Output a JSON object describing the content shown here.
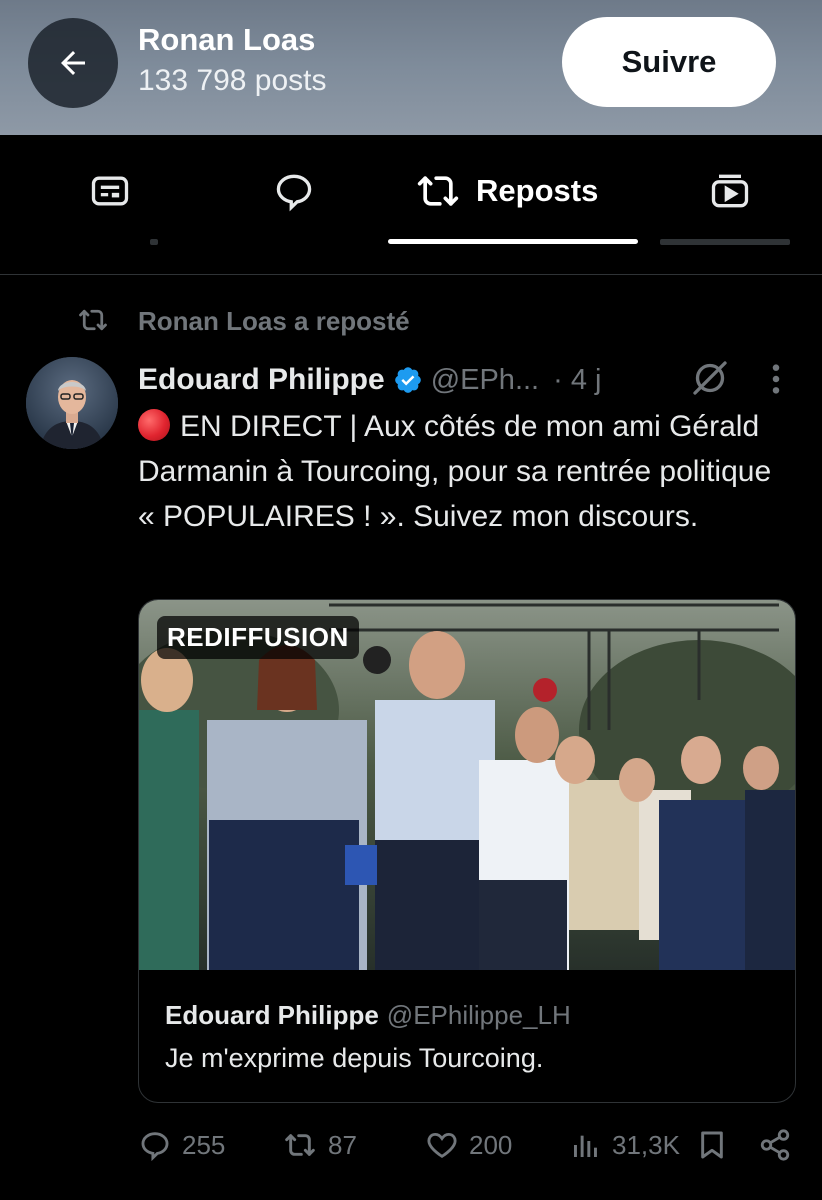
{
  "header": {
    "name": "Ronan Loas",
    "posts_count": "133 798 posts",
    "follow_label": "Suivre",
    "back_icon": "arrow-left-icon"
  },
  "tabs": [
    {
      "icon": "article-icon",
      "label": ""
    },
    {
      "icon": "reply-bubble-icon",
      "label": ""
    },
    {
      "icon": "repost-icon",
      "label": "Reposts",
      "active": true
    },
    {
      "icon": "video-icon",
      "label": ""
    }
  ],
  "post": {
    "repost_banner": "Ronan Loas a reposté",
    "author_name": "Edouard Philippe",
    "verified": true,
    "handle": "@EPh...",
    "time": "· 4 j",
    "text_emoji": "red-circle",
    "text": "EN DIRECT | Aux côtés de mon ami Gérald Darmanin à Tourcoing, pour sa rentrée politique « POPULAIRES ! ». Suivez mon discours.",
    "media_badge": "REDIFFUSION",
    "quote": {
      "author_name": "Edouard Philippe",
      "handle": "@EPhilippe_LH",
      "text": "Je m'exprime depuis Tourcoing."
    },
    "actions": {
      "replies": "255",
      "reposts": "87",
      "likes": "200",
      "views": "31,3K"
    }
  },
  "colors": {
    "background": "#000000",
    "text": "#e7e9ea",
    "muted": "#71767b",
    "verified": "#1d9bf0",
    "divider": "#2f3336"
  }
}
